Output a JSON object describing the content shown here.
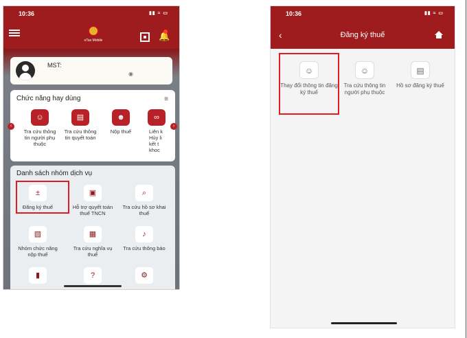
{
  "left_screen": {
    "status": {
      "time": "10:36",
      "icons": "▮▮ ≈ ▭"
    },
    "app_brand": "eTax Mobile",
    "user": {
      "mst_label": "MST:"
    },
    "frequent_functions": {
      "title": "Chức năng hay dùng",
      "items": [
        {
          "label": "Tra cứu thông tin người phụ thuộc",
          "icon": "user-search-icon"
        },
        {
          "label": "Tra cứu thông tin quyết toán",
          "icon": "document-search-icon"
        },
        {
          "label": "Nộp thuế",
          "icon": "pay-tax-icon"
        },
        {
          "label": "Liên k Hủy li kết t khoc",
          "icon": "link-icon"
        }
      ]
    },
    "service_groups": {
      "title": "Danh sách nhóm dịch vụ",
      "items": [
        {
          "label": "Đăng ký thuế",
          "icon": "register-tax-icon"
        },
        {
          "label": "Hỗ trợ quyết toán thuế TNCN",
          "icon": "tax-settlement-icon"
        },
        {
          "label": "Tra cứu hồ sơ khai thuế",
          "icon": "search-file-icon"
        },
        {
          "label": "Nhóm chức năng nộp thuế",
          "icon": "pay-group-icon"
        },
        {
          "label": "Tra cứu nghĩa vụ thuế",
          "icon": "obligation-icon"
        },
        {
          "label": "Tra cứu thông báo",
          "icon": "notification-icon"
        },
        {
          "label": "",
          "icon": "book-icon"
        },
        {
          "label": "",
          "icon": "help-icon"
        },
        {
          "label": "",
          "icon": "settings-icon"
        }
      ]
    }
  },
  "right_screen": {
    "status": {
      "time": "10:36",
      "icons": "▮▮ ≈ ▭"
    },
    "title": "Đăng ký thuế",
    "items": [
      {
        "label": "Thay đổi thông tin đăng ký thuế",
        "icon": "edit-user-icon"
      },
      {
        "label": "Tra cứu thông tin người phụ thuộc",
        "icon": "search-user-icon"
      },
      {
        "label": "Hồ sơ đăng ký thuế",
        "icon": "document-icon"
      }
    ]
  },
  "colors": {
    "brand_red": "#9e1c1e",
    "icon_red": "#b82127",
    "highlight": "#e11b22"
  }
}
